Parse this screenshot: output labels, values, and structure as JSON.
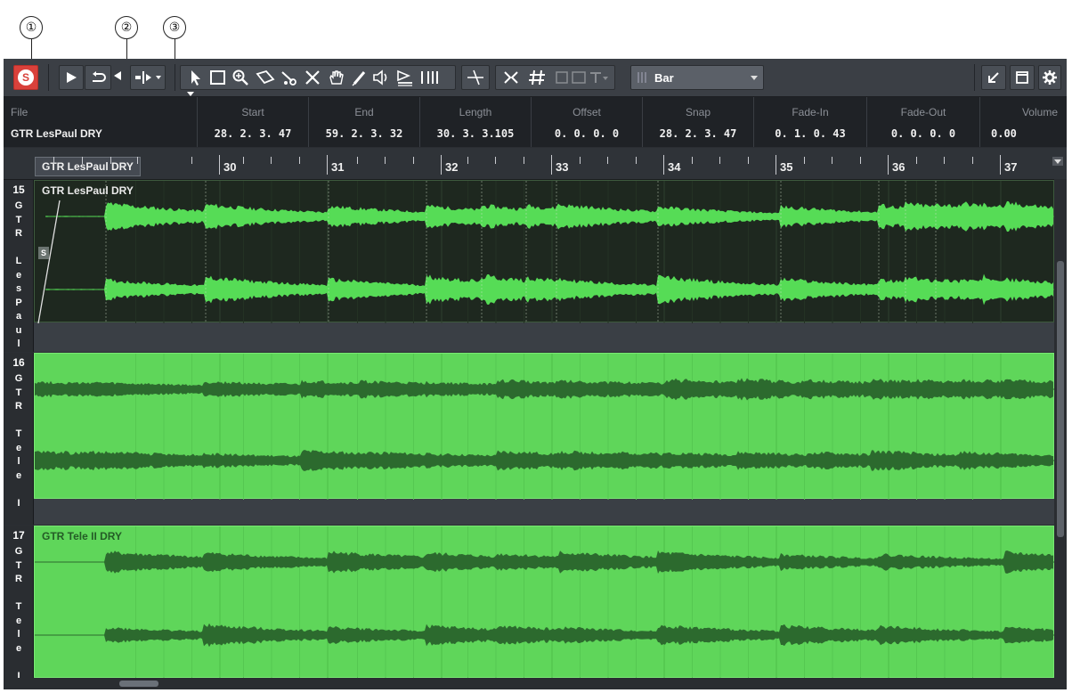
{
  "callouts": [
    "①",
    "②",
    "③"
  ],
  "toolbar": {
    "solo_label": "S",
    "snap_type": "Bar",
    "icons": [
      "solo-icon",
      "play-icon",
      "loop-icon",
      "transport-menu-icon",
      "object-select-icon",
      "range-select-icon",
      "zoom-icon",
      "glue-icon",
      "split-icon",
      "erase-icon",
      "mute-hand-icon",
      "draw-icon",
      "play-tool-icon",
      "comp-icon",
      "line-tool-icon",
      "snap-icon",
      "grid-icon",
      "quantize-icon",
      "collapse-icon",
      "window-icon",
      "settings-gear-icon"
    ]
  },
  "colors": {
    "solo": "#d9413b",
    "event_dark": "#1e281f",
    "waveform_bright": "#56dc56",
    "event_selected": "#5fd65a",
    "waveform_dark": "#2c6a2e"
  },
  "infoline": {
    "columns": [
      {
        "header": "File",
        "value": "GTR LesPaul DRY"
      },
      {
        "header": "Start",
        "value": "28. 2. 3. 47"
      },
      {
        "header": "End",
        "value": "59. 2. 3. 32"
      },
      {
        "header": "Length",
        "value": "30. 3. 3.105"
      },
      {
        "header": "Offset",
        "value": "0. 0. 0.   0"
      },
      {
        "header": "Snap",
        "value": "28. 2. 3. 47"
      },
      {
        "header": "Fade-In",
        "value": "0. 1. 0. 43"
      },
      {
        "header": "Fade-Out",
        "value": "0. 0. 0.   0"
      },
      {
        "header": "Volume",
        "value": "0.00"
      }
    ]
  },
  "ruler": {
    "track_label": "GTR LesPaul DRY",
    "bars": [
      "30",
      "31",
      "32",
      "33",
      "34",
      "35",
      "36",
      "37"
    ]
  },
  "tracks": [
    {
      "number": "15",
      "vertical_name": "G\nT\nR\n\nL\ne\ns\nP\na\nu\nl",
      "event_title": "GTR LesPaul DRY",
      "style": "dark",
      "fade_label": "S"
    },
    {
      "number": "16",
      "vertical_name": "G\nT\nR\n\nT\ne\nl\ne\n\nI\n\nD",
      "event_title": "",
      "style": "selected"
    },
    {
      "number": "17",
      "vertical_name": "G\nT\nR\n\nT\ne\nl\ne\n\nI",
      "event_title": "GTR Tele II DRY",
      "style": "selected"
    }
  ]
}
